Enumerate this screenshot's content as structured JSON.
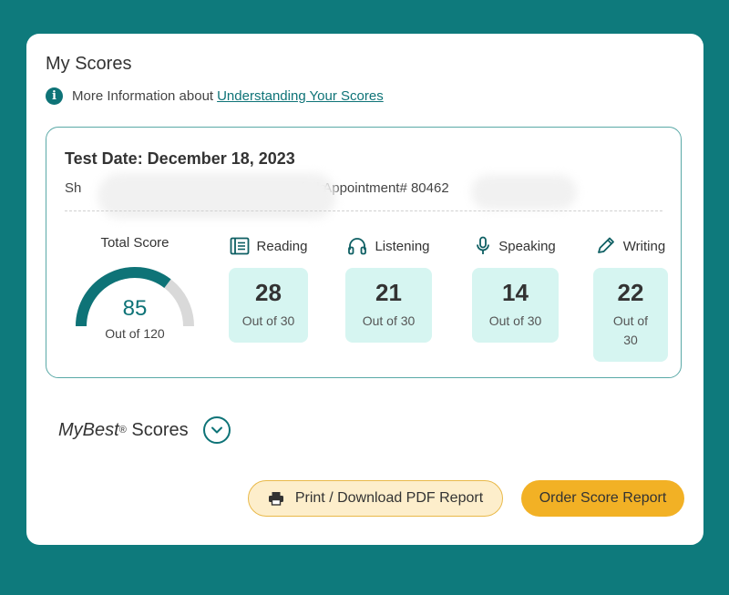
{
  "page": {
    "title": "My Scores",
    "info_text": "More Information about",
    "info_link": "Understanding Your Scores"
  },
  "score_card": {
    "test_date": "Test Date: December 18, 2023",
    "candidate_partial": "Sh",
    "candidate_suffix": "dova",
    "appointment_label": "| Appointment# 80462",
    "total": {
      "label": "Total Score",
      "value": "85",
      "max": 120,
      "out_of": "Out of 120"
    },
    "sections": [
      {
        "name": "Reading",
        "icon": "book-icon",
        "score": "28",
        "out_of": "Out of 30"
      },
      {
        "name": "Listening",
        "icon": "headphones-icon",
        "score": "21",
        "out_of": "Out of 30"
      },
      {
        "name": "Speaking",
        "icon": "microphone-icon",
        "score": "14",
        "out_of": "Out of 30"
      },
      {
        "name": "Writing",
        "icon": "pencil-icon",
        "score": "22",
        "out_of": "Out of 30"
      }
    ]
  },
  "mybest": {
    "title_em": "MyBest",
    "registered": "®",
    "title_rest": "Scores"
  },
  "actions": {
    "print_label": "Print / Download PDF Report",
    "order_label": "Order Score Report"
  },
  "colors": {
    "background": "#0e7a7c",
    "accent": "#0e7377",
    "tile": "#d6f5f1",
    "button_yellow": "#f2b125",
    "button_light": "#fdeecb"
  }
}
